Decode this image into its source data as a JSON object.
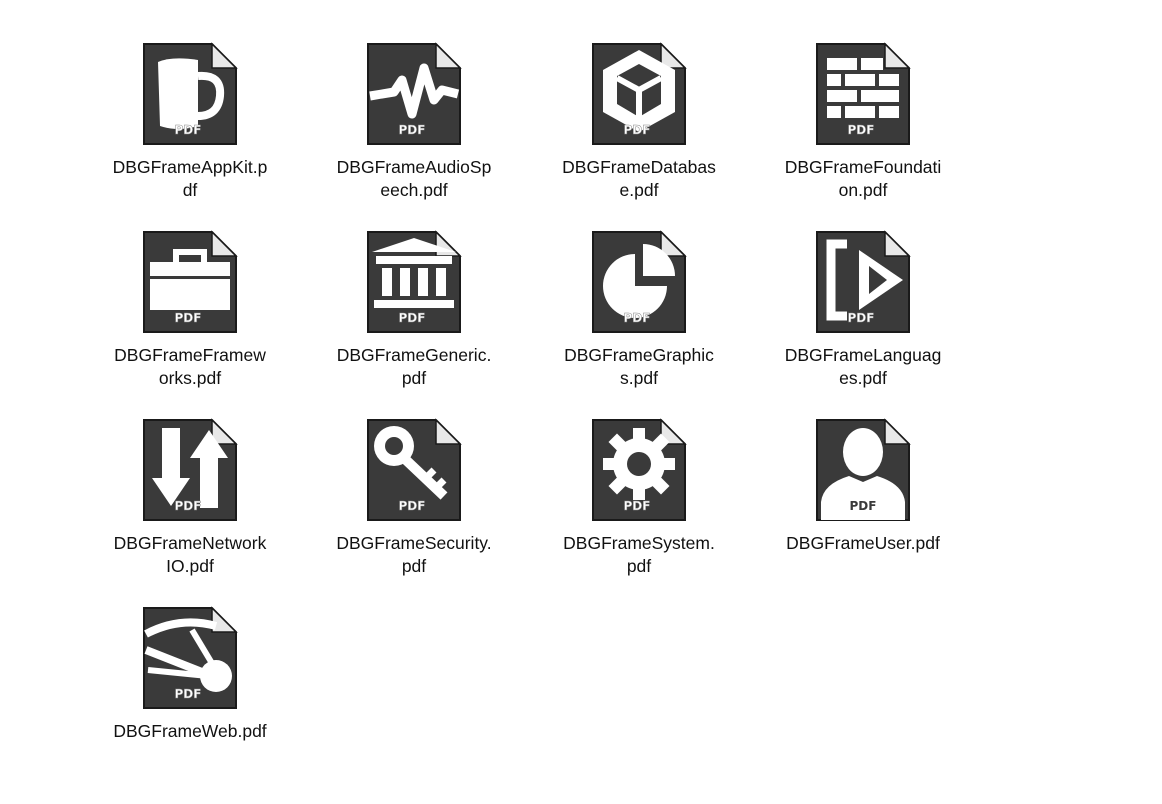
{
  "window": {
    "background": "#ffffff"
  },
  "icon_colors": {
    "page": "#3a3a3a",
    "glyph": "#ffffff",
    "fold": "#e8e8e8"
  },
  "files": [
    {
      "id": "appkit",
      "name_line1": "DBGFrameAppKit.p",
      "name_line2": "df",
      "icon": "mug-icon",
      "badge": "PDF"
    },
    {
      "id": "audiospeech",
      "name_line1": "DBGFrameAudioSp",
      "name_line2": "eech.pdf",
      "icon": "waveform-icon",
      "badge": "PDF"
    },
    {
      "id": "database",
      "name_line1": "DBGFrameDatabas",
      "name_line2": "e.pdf",
      "icon": "cube-icon",
      "badge": "PDF"
    },
    {
      "id": "foundation",
      "name_line1": "DBGFrameFoundati",
      "name_line2": "on.pdf",
      "icon": "bricks-icon",
      "badge": "PDF"
    },
    {
      "id": "frameworks",
      "name_line1": "DBGFrameFramew",
      "name_line2": "orks.pdf",
      "icon": "briefcase-icon",
      "badge": "PDF"
    },
    {
      "id": "generic",
      "name_line1": "DBGFrameGeneric.",
      "name_line2": "pdf",
      "icon": "building-icon",
      "badge": "PDF"
    },
    {
      "id": "graphics",
      "name_line1": "DBGFrameGraphic",
      "name_line2": "s.pdf",
      "icon": "pie-chart-icon",
      "badge": "PDF"
    },
    {
      "id": "languages",
      "name_line1": "DBGFrameLanguag",
      "name_line2": "es.pdf",
      "icon": "bracket-play-icon",
      "badge": "PDF"
    },
    {
      "id": "networkio",
      "name_line1": "DBGFrameNetwork",
      "name_line2": "IO.pdf",
      "icon": "arrows-up-down-icon",
      "badge": "PDF"
    },
    {
      "id": "security",
      "name_line1": "DBGFrameSecurity.",
      "name_line2": "pdf",
      "icon": "key-icon",
      "badge": "PDF"
    },
    {
      "id": "system",
      "name_line1": "DBGFrameSystem.",
      "name_line2": "pdf",
      "icon": "gear-icon",
      "badge": "PDF"
    },
    {
      "id": "user",
      "name_line1": "DBGFrameUser.pdf",
      "name_line2": "",
      "icon": "user-silhouette-icon",
      "badge": "PDF"
    },
    {
      "id": "web",
      "name_line1": "DBGFrameWeb.pdf",
      "name_line2": "",
      "icon": "network-node-icon",
      "badge": "PDF"
    }
  ]
}
